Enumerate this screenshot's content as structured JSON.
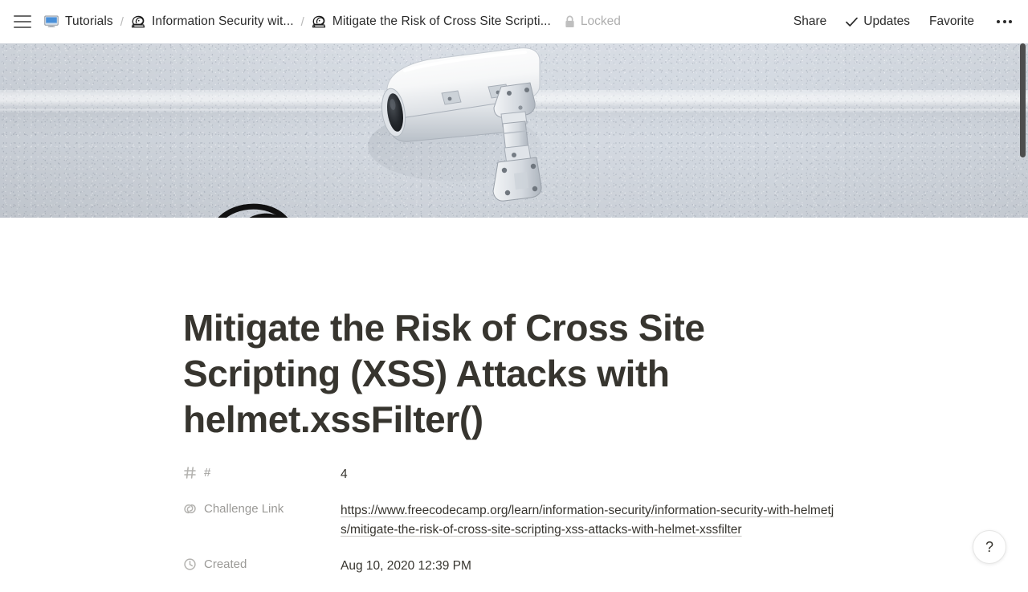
{
  "topbar": {
    "menu_icon": "hamburger-icon",
    "breadcrumb": [
      {
        "label": "Tutorials",
        "icon": "monitor-icon"
      },
      {
        "label": "Information Security wit...",
        "icon": "helmet-icon"
      },
      {
        "label": "Mitigate the Risk of Cross Site Scripti...",
        "icon": "helmet-icon"
      }
    ],
    "separator": "/",
    "locked": {
      "label": "Locked",
      "icon": "lock-icon"
    },
    "actions": [
      {
        "label": "Share",
        "icon": null
      },
      {
        "label": "Updates",
        "icon": "check-icon"
      },
      {
        "label": "Favorite",
        "icon": null
      }
    ],
    "more_icon": "ellipsis-icon"
  },
  "hero": {
    "alt": "white cctv security camera mounted on a speckled concrete wall",
    "wall_color": "#d2d8e0",
    "page_icon": "freecodecamp-helmet-icon"
  },
  "page": {
    "title": "Mitigate the Risk of Cross Site Scripting (XSS) Attacks with helmet.xssFilter()",
    "properties": [
      {
        "icon": "hash-icon",
        "key": "#",
        "value": "4",
        "is_link": false
      },
      {
        "icon": "link-icon",
        "key": "Challenge Link",
        "value": "https://www.freecodecamp.org/learn/information-security/information-security-with-helmetjs/mitigate-the-risk-of-cross-site-scripting-xss-attacks-with-helmet-xssfilter",
        "is_link": true
      },
      {
        "icon": "clock-icon",
        "key": "Created",
        "value": "Aug 10, 2020 12:39 PM",
        "is_link": false
      }
    ]
  },
  "help": {
    "label": "?",
    "icon": "question-mark-icon"
  },
  "scrollbar": {
    "thumb_color": "#4d4d4d",
    "thumb_top": 0,
    "thumb_height": 142
  },
  "colors": {
    "text_primary": "#37352f",
    "text_muted": "#9b9a97",
    "accent_blue": "#4a90d9"
  }
}
